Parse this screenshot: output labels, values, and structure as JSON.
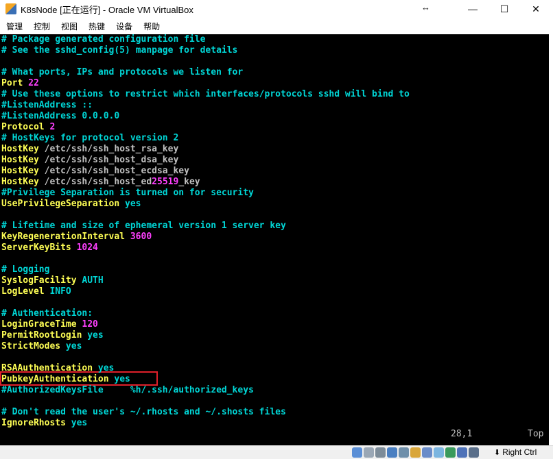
{
  "window": {
    "title": "K8sNode [正在运行] - Oracle VM VirtualBox",
    "resize_indicator": "↔",
    "minimize": "—",
    "maximize": "☐",
    "close": "✕"
  },
  "menu": [
    "管理",
    "控制",
    "视图",
    "热键",
    "设备",
    "帮助"
  ],
  "terminal": {
    "lines": [
      [
        [
          "c",
          "# Package generated configuration file"
        ]
      ],
      [
        [
          "c",
          "# See the sshd_config(5) manpage for details"
        ]
      ],
      [],
      [
        [
          "c",
          "# What ports, IPs and protocols we listen for"
        ]
      ],
      [
        [
          "k",
          "Port "
        ],
        [
          "v",
          "22"
        ]
      ],
      [
        [
          "c",
          "# Use these options to restrict which interfaces/protocols sshd will bind to"
        ]
      ],
      [
        [
          "c",
          "#ListenAddress ::"
        ]
      ],
      [
        [
          "c",
          "#ListenAddress 0.0.0.0"
        ]
      ],
      [
        [
          "k",
          "Protocol "
        ],
        [
          "v",
          "2"
        ]
      ],
      [
        [
          "c",
          "# HostKeys for protocol version 2"
        ]
      ],
      [
        [
          "k",
          "HostKey "
        ],
        [
          "w",
          "/etc/ssh/ssh_host_rsa_key"
        ]
      ],
      [
        [
          "k",
          "HostKey "
        ],
        [
          "w",
          "/etc/ssh/ssh_host_dsa_key"
        ]
      ],
      [
        [
          "k",
          "HostKey "
        ],
        [
          "w",
          "/etc/ssh/ssh_host_ecdsa_key"
        ]
      ],
      [
        [
          "k",
          "HostKey "
        ],
        [
          "w",
          "/etc/ssh/ssh_host_ed"
        ],
        [
          "v",
          "25519"
        ],
        [
          "w",
          "_key"
        ]
      ],
      [
        [
          "c",
          "#Privilege Separation is turned on for security"
        ]
      ],
      [
        [
          "k",
          "UsePrivilegeSeparation "
        ],
        [
          "c",
          "yes"
        ]
      ],
      [],
      [
        [
          "c",
          "# Lifetime and size of ephemeral version 1 server key"
        ]
      ],
      [
        [
          "k",
          "KeyRegenerationInterval "
        ],
        [
          "v",
          "3600"
        ]
      ],
      [
        [
          "k",
          "ServerKeyBits "
        ],
        [
          "v",
          "1024"
        ]
      ],
      [],
      [
        [
          "c",
          "# Logging"
        ]
      ],
      [
        [
          "k",
          "SyslogFacility "
        ],
        [
          "c",
          "AUTH"
        ]
      ],
      [
        [
          "k",
          "LogLevel "
        ],
        [
          "c",
          "INFO"
        ]
      ],
      [],
      [
        [
          "c",
          "# Authentication:"
        ]
      ],
      [
        [
          "k",
          "LoginGraceTime "
        ],
        [
          "v",
          "120"
        ]
      ],
      [
        [
          "k",
          "PermitRootLogin "
        ],
        [
          "c",
          "yes"
        ]
      ],
      [
        [
          "k",
          "StrictModes "
        ],
        [
          "c",
          "yes"
        ]
      ],
      [],
      [
        [
          "k",
          "RSAAuthentication "
        ],
        [
          "c",
          "yes"
        ]
      ],
      [
        [
          "k",
          "PubkeyAuthentication "
        ],
        [
          "c",
          "yes"
        ]
      ],
      [
        [
          "c",
          "#AuthorizedKeysFile     %h/.ssh/authorized_keys"
        ]
      ],
      [],
      [
        [
          "c",
          "# Don't read the user's ~/.rhosts and ~/.shosts files"
        ]
      ],
      [
        [
          "k",
          "IgnoreRhosts "
        ],
        [
          "c",
          "yes"
        ]
      ]
    ],
    "cursor_position": "28,1",
    "scroll_position": "Top"
  },
  "statusbar": {
    "icons": [
      "hard-disk-icon",
      "optical-drive-icon",
      "audio-icon",
      "network-icon",
      "usb-icon",
      "shared-folder-icon",
      "display-icon",
      "video-capture-icon",
      "cpu-icon",
      "mouse-integration-icon",
      "keyboard-capture-icon"
    ],
    "icon_colors": [
      "#5b8fd6",
      "#9aa7b5",
      "#7d8c99",
      "#4a7fc1",
      "#6f8faa",
      "#d9a63a",
      "#6a8cc9",
      "#7bb5e0",
      "#3a9a5c",
      "#4e72b8",
      "#5a6f8a"
    ],
    "host_key": "Right Ctrl"
  },
  "colors": {
    "comment": "#00d7d7",
    "keyword": "#ffff55",
    "number": "#ff40ff",
    "highlight_border": "#e0202a"
  }
}
